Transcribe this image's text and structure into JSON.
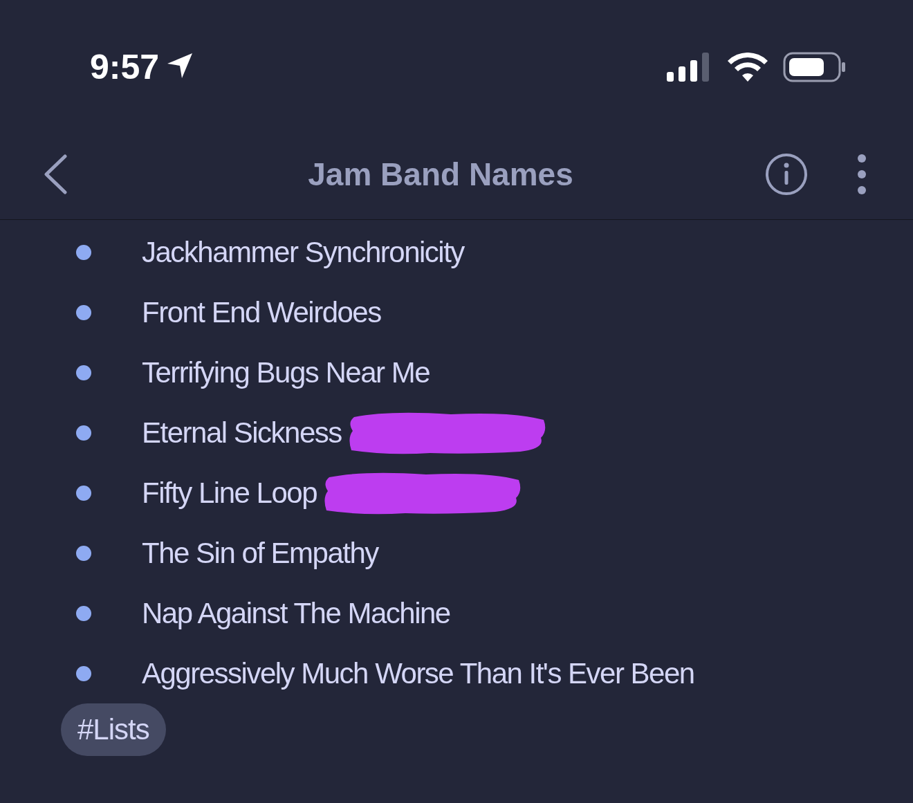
{
  "status_bar": {
    "time": "9:57"
  },
  "nav": {
    "title": "Jam Band Names"
  },
  "items": [
    {
      "text": "Jackhammer Synchronicity",
      "redacted": false
    },
    {
      "text": "Front End Weirdoes",
      "redacted": false
    },
    {
      "text": "Terrifying Bugs Near Me",
      "redacted": false
    },
    {
      "text": "Eternal Sickness",
      "redacted": true
    },
    {
      "text": "Fifty Line Loop",
      "redacted": true
    },
    {
      "text": "The Sin of Empathy",
      "redacted": false
    },
    {
      "text": "Nap Against The Machine",
      "redacted": false
    },
    {
      "text": "Aggressively Much Worse Than It's Ever Been",
      "redacted": false
    }
  ],
  "tags": [
    "#Lists"
  ]
}
